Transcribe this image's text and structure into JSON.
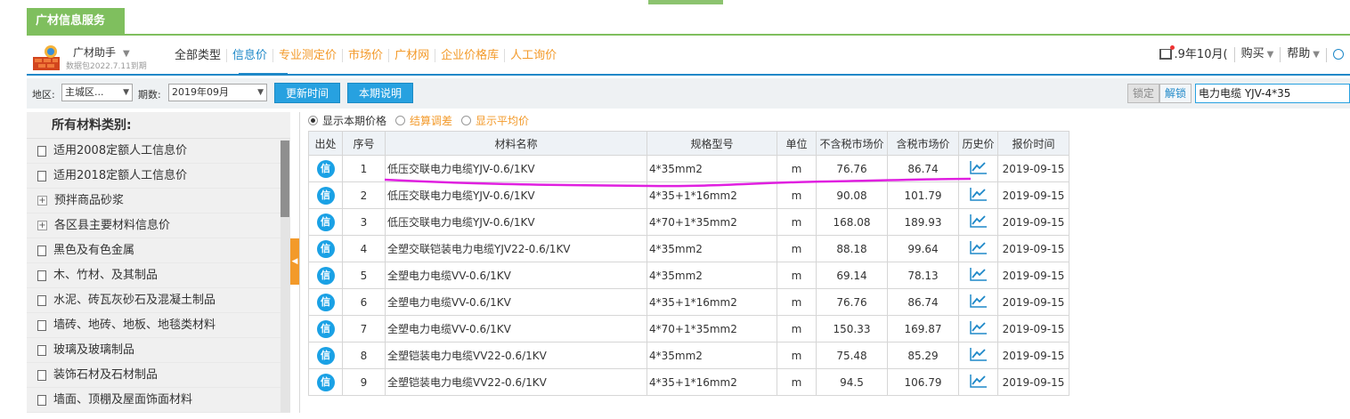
{
  "service_tab": "广材信息服务",
  "header": {
    "brand": "广材助手",
    "brand_sub": "数据包2022.7.11到期",
    "nav": [
      "全部类型",
      "信息价",
      "专业测定价",
      "市场价",
      "广材网",
      "企业价格库",
      "人工询价"
    ],
    "active_nav": "信息价",
    "right_nav": [
      ".9年10月(",
      "购买",
      "帮助"
    ]
  },
  "filters": {
    "region_label": "地区:",
    "region_value": "主城区...",
    "period_label": "期数:",
    "period_value": "2019年09月",
    "update_button": "更新时间",
    "notes_button": "本期说明",
    "lock_button": "锁定",
    "unlock_button": "解锁",
    "search_value": "电力电缆 YJV-4*35"
  },
  "sidebar": {
    "title": "所有材料类别:",
    "items": [
      {
        "label": "适用2008定额人工信息价",
        "icon": "doc"
      },
      {
        "label": "适用2018定额人工信息价",
        "icon": "doc"
      },
      {
        "label": "预拌商品砂浆",
        "icon": "plus"
      },
      {
        "label": "各区县主要材料信息价",
        "icon": "plus"
      },
      {
        "label": "黑色及有色金属",
        "icon": "doc"
      },
      {
        "label": "木、竹材、及其制品",
        "icon": "doc"
      },
      {
        "label": "水泥、砖瓦灰砂石及混凝土制品",
        "icon": "doc"
      },
      {
        "label": "墙砖、地砖、地板、地毯类材料",
        "icon": "doc"
      },
      {
        "label": "玻璃及玻璃制品",
        "icon": "doc"
      },
      {
        "label": "装饰石材及石材制品",
        "icon": "doc"
      },
      {
        "label": "墙面、顶棚及屋面饰面材料",
        "icon": "doc"
      }
    ]
  },
  "radios": [
    {
      "label": "显示本期价格",
      "checked": true,
      "color": "#333333"
    },
    {
      "label": "结算调差",
      "checked": false,
      "color": "#f39a2a"
    },
    {
      "label": "显示平均价",
      "checked": false,
      "color": "#f39a2a"
    }
  ],
  "table": {
    "headers": [
      "出处",
      "序号",
      "材料名称",
      "规格型号",
      "单位",
      "不含税市场价",
      "含税市场价",
      "历史价",
      "报价时间"
    ],
    "source_badge": "信",
    "rows": [
      {
        "no": "1",
        "name": "低压交联电力电缆YJV-0.6/1KV",
        "spec": "4*35mm2",
        "unit": "m",
        "price_ex": "76.76",
        "price_in": "86.74",
        "date": "2019-09-15"
      },
      {
        "no": "2",
        "name": "低压交联电力电缆YJV-0.6/1KV",
        "spec": "4*35+1*16mm2",
        "unit": "m",
        "price_ex": "90.08",
        "price_in": "101.79",
        "date": "2019-09-15"
      },
      {
        "no": "3",
        "name": "低压交联电力电缆YJV-0.6/1KV",
        "spec": "4*70+1*35mm2",
        "unit": "m",
        "price_ex": "168.08",
        "price_in": "189.93",
        "date": "2019-09-15"
      },
      {
        "no": "4",
        "name": "全塑交联铠装电力电缆YJV22-0.6/1KV",
        "spec": "4*35mm2",
        "unit": "m",
        "price_ex": "88.18",
        "price_in": "99.64",
        "date": "2019-09-15"
      },
      {
        "no": "5",
        "name": "全塑电力电缆VV-0.6/1KV",
        "spec": "4*35mm2",
        "unit": "m",
        "price_ex": "69.14",
        "price_in": "78.13",
        "date": "2019-09-15"
      },
      {
        "no": "6",
        "name": "全塑电力电缆VV-0.6/1KV",
        "spec": "4*35+1*16mm2",
        "unit": "m",
        "price_ex": "76.76",
        "price_in": "86.74",
        "date": "2019-09-15"
      },
      {
        "no": "7",
        "name": "全塑电力电缆VV-0.6/1KV",
        "spec": "4*70+1*35mm2",
        "unit": "m",
        "price_ex": "150.33",
        "price_in": "169.87",
        "date": "2019-09-15"
      },
      {
        "no": "8",
        "name": "全塑铠装电力电缆VV22-0.6/1KV",
        "spec": "4*35mm2",
        "unit": "m",
        "price_ex": "75.48",
        "price_in": "85.29",
        "date": "2019-09-15"
      },
      {
        "no": "9",
        "name": "全塑铠装电力电缆VV22-0.6/1KV",
        "spec": "4*35+1*16mm2",
        "unit": "m",
        "price_ex": "94.5",
        "price_in": "106.79",
        "date": "2019-09-15"
      }
    ]
  },
  "colors": {
    "accent_blue": "#1e88c8",
    "accent_orange": "#f39a2a",
    "brand_green": "#7fbf5e",
    "annotation": "#e020e0"
  }
}
